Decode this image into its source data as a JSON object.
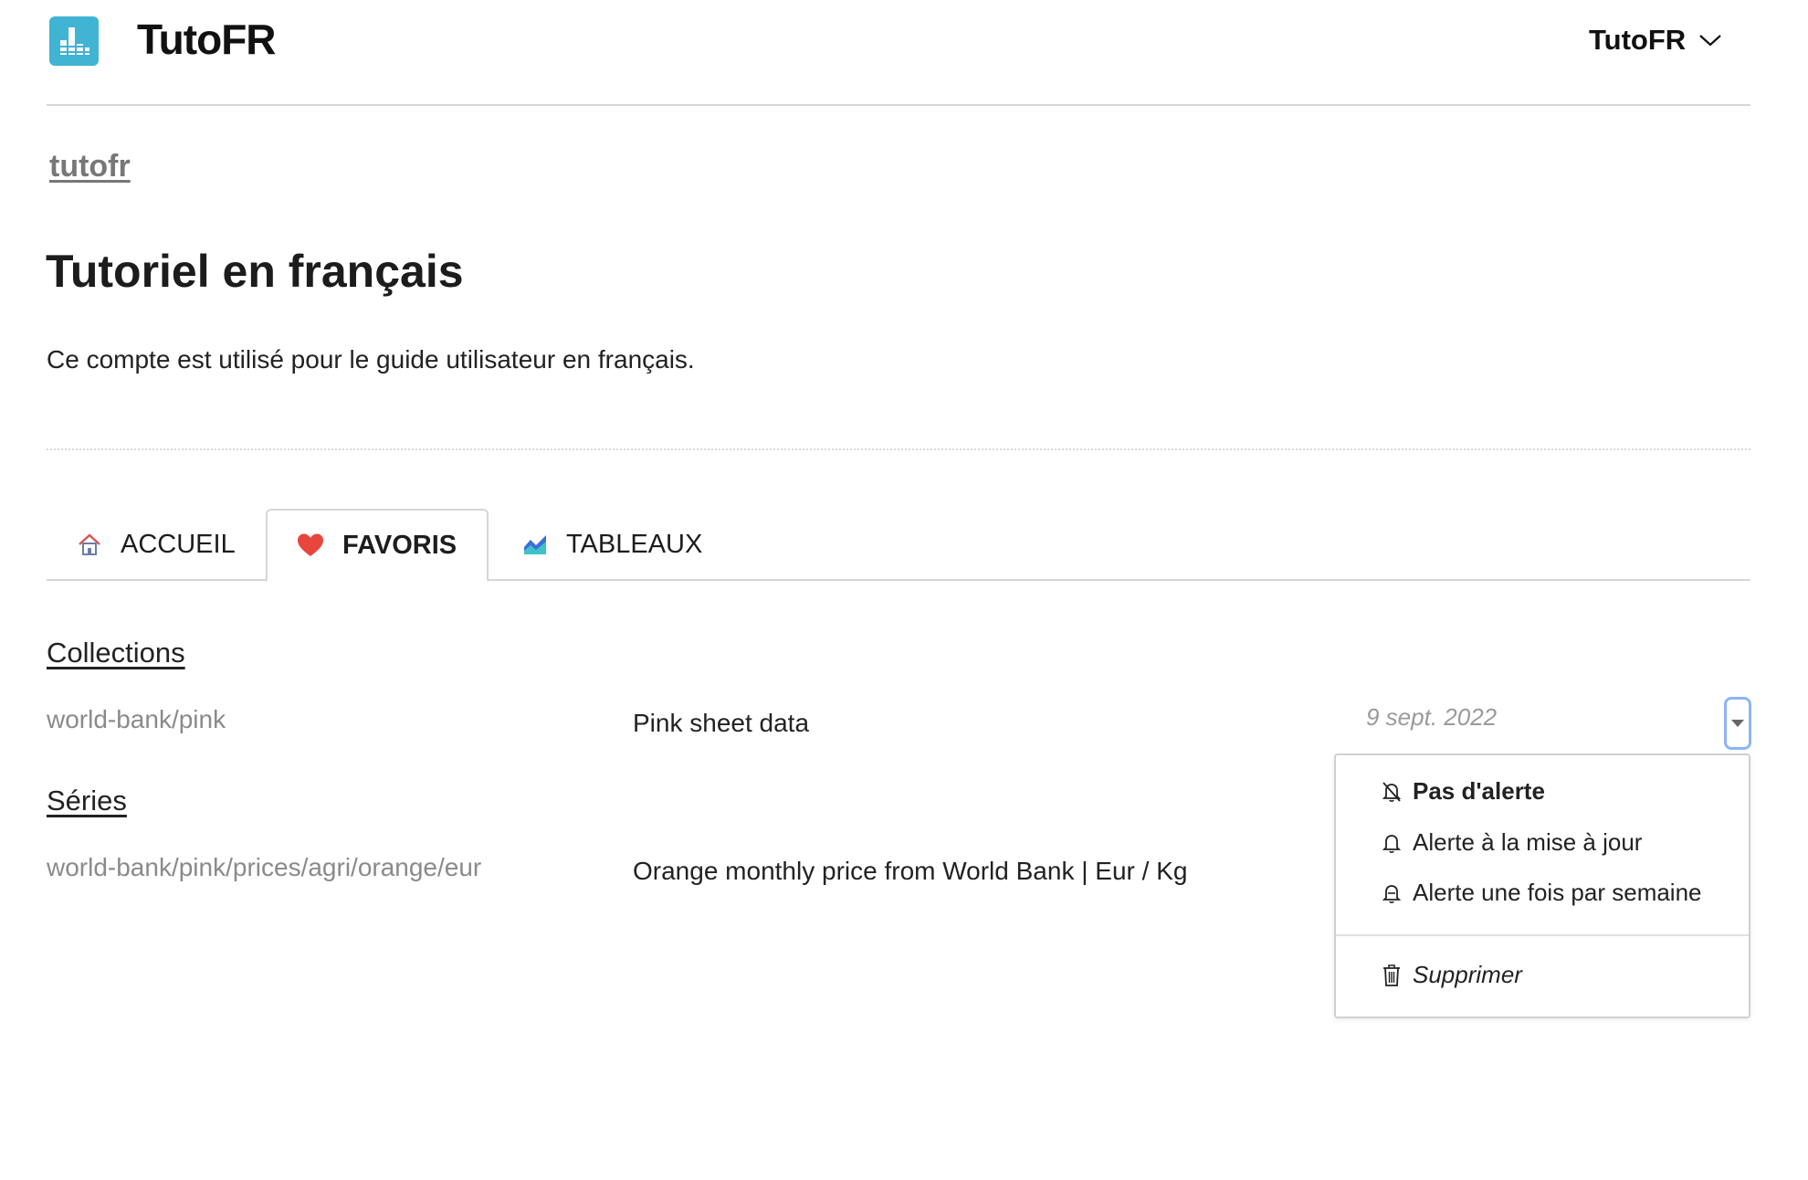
{
  "header": {
    "brand": "TutoFR",
    "user_menu_label": "TutoFR"
  },
  "account": {
    "slug": "tutofr",
    "title": "Tutoriel en français",
    "description": "Ce compte est utilisé pour le guide utilisateur en français."
  },
  "tabs": [
    {
      "label": "ACCUEIL",
      "icon": "home-icon",
      "active": false
    },
    {
      "label": "FAVORIS",
      "icon": "heart-icon",
      "active": true
    },
    {
      "label": "TABLEAUX",
      "icon": "chart-icon",
      "active": false
    }
  ],
  "collections": {
    "title": "Collections",
    "items": [
      {
        "slug": "world-bank/pink",
        "description": "Pink sheet data",
        "date": "9 sept. 2022"
      }
    ]
  },
  "series": {
    "title": "Séries",
    "items": [
      {
        "slug": "world-bank/pink/prices/agri/orange/eur",
        "description": "Orange monthly price from World Bank | Eur / Kg"
      }
    ]
  },
  "dropdown_menu": {
    "items": [
      {
        "label": "Pas d'alerte",
        "icon": "bell-off-icon",
        "selected": true
      },
      {
        "label": "Alerte à la mise à jour",
        "icon": "bell-icon",
        "selected": false
      },
      {
        "label": "Alerte une fois par semaine",
        "icon": "bell-calendar-icon",
        "selected": false
      }
    ],
    "delete_label": "Supprimer"
  },
  "colors": {
    "logo": "#41b3d3",
    "heart": "#e8453c",
    "focus_ring": "#8fb4f5"
  }
}
